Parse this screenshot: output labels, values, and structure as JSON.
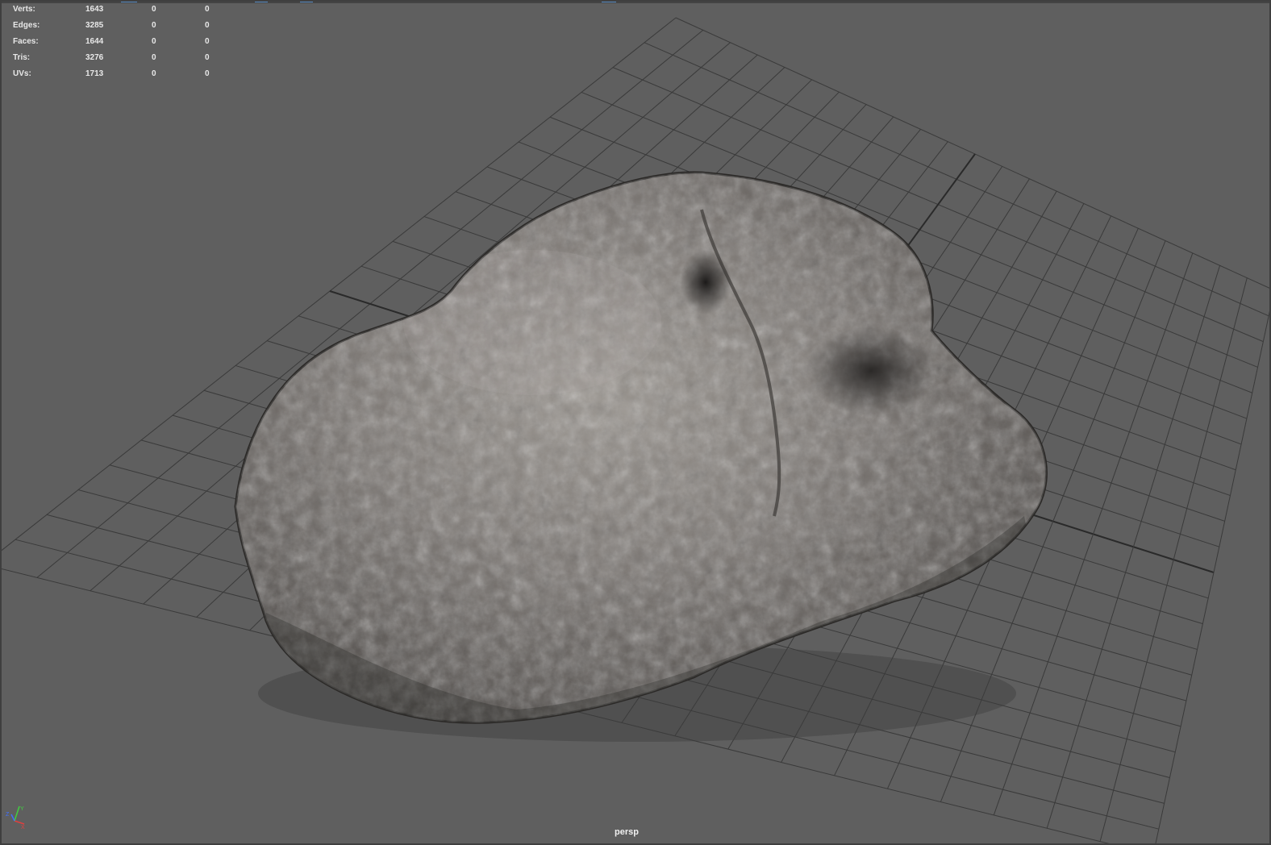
{
  "hud": {
    "rows": [
      {
        "label": "Verts:",
        "values": [
          "1643",
          "0",
          "0"
        ]
      },
      {
        "label": "Edges:",
        "values": [
          "3285",
          "0",
          "0"
        ]
      },
      {
        "label": "Faces:",
        "values": [
          "1644",
          "0",
          "0"
        ]
      },
      {
        "label": "Tris:",
        "values": [
          "3276",
          "0",
          "0"
        ]
      },
      {
        "label": "UVs:",
        "values": [
          "1713",
          "0",
          "0"
        ]
      }
    ]
  },
  "viewport": {
    "camera": "persp",
    "background_color": "#5f5f5f",
    "grid_color": "#3a3a3a",
    "grid_axis_color": "#2a2a2a",
    "object": "rock-mesh",
    "rock_colors": [
      "#8a8580",
      "#6e6a66",
      "#4b4845",
      "#a8a39e",
      "#2f2d2b"
    ]
  },
  "axis_gizmo": {
    "x_label": "X",
    "y_label": "Y",
    "z_label": "Z",
    "x_color": "#e04040",
    "y_color": "#40d040",
    "z_color": "#4070ff"
  }
}
